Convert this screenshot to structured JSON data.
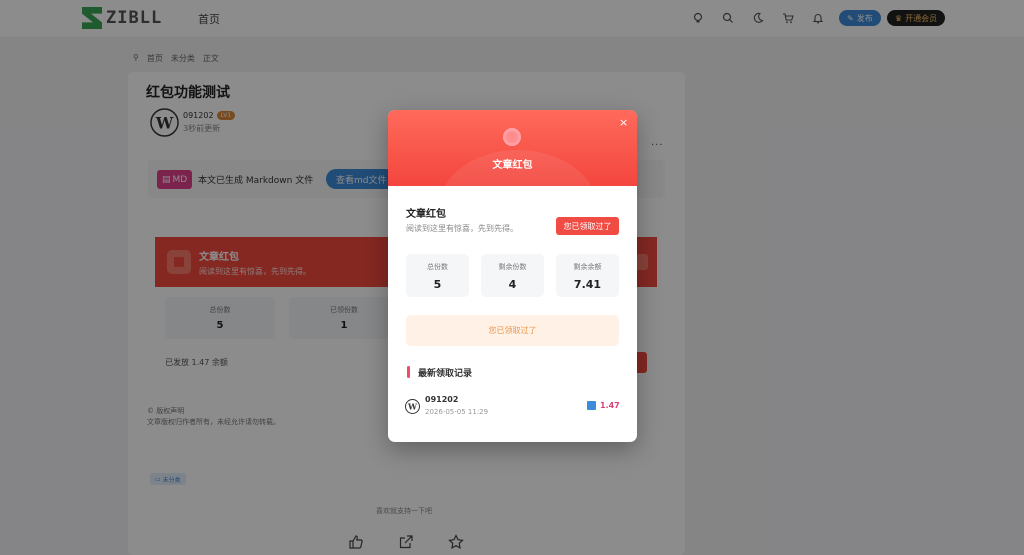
{
  "header": {
    "logo_text": "ZIBLL",
    "nav_home": "首页",
    "publish_label": "发布",
    "vip_label": "开通会员"
  },
  "breadcrumb": [
    "首页",
    "未分类",
    "正文"
  ],
  "article": {
    "title": "红包功能测试",
    "author": "091202",
    "level_badge": "LV1",
    "updated": "3秒前更新",
    "more": "···",
    "md_label": "MD",
    "md_text": "本文已生成 Markdown 文件",
    "md_button": "查看md文件",
    "redpacket_banner_title": "文章红包",
    "redpacket_banner_sub": "阅读到这里有惊喜，先到先得。",
    "stats": [
      {
        "label": "总份数",
        "value": "5"
      },
      {
        "label": "已领份数",
        "value": "1"
      }
    ],
    "sent_text": "已发放 1.47 余额",
    "copyright_title": "© 版权声明",
    "copyright_text": "文章版权归作者所有，未经允许请勿转载。",
    "tag": "未分类",
    "support_text": "喜欢就支持一下吧"
  },
  "modal": {
    "header_title": "文章红包",
    "close_label": "×",
    "title": "文章红包",
    "subtitle": "阅读到这里有惊喜，先到先得。",
    "claimed_badge": "您已领取过了",
    "stats": [
      {
        "label": "总份数",
        "value": "5"
      },
      {
        "label": "剩余份数",
        "value": "4"
      },
      {
        "label": "剩余余额",
        "value": "7.41"
      }
    ],
    "claimed_bar": "您已领取过了",
    "records_title": "最新领取记录",
    "records": [
      {
        "name": "091202",
        "time": "2026-05-05 11:29",
        "amount": "1.47"
      }
    ]
  },
  "colors": {
    "accent_red": "#f24a3e",
    "accent_blue": "#3d8bd9",
    "brand_green": "#3aa657"
  }
}
